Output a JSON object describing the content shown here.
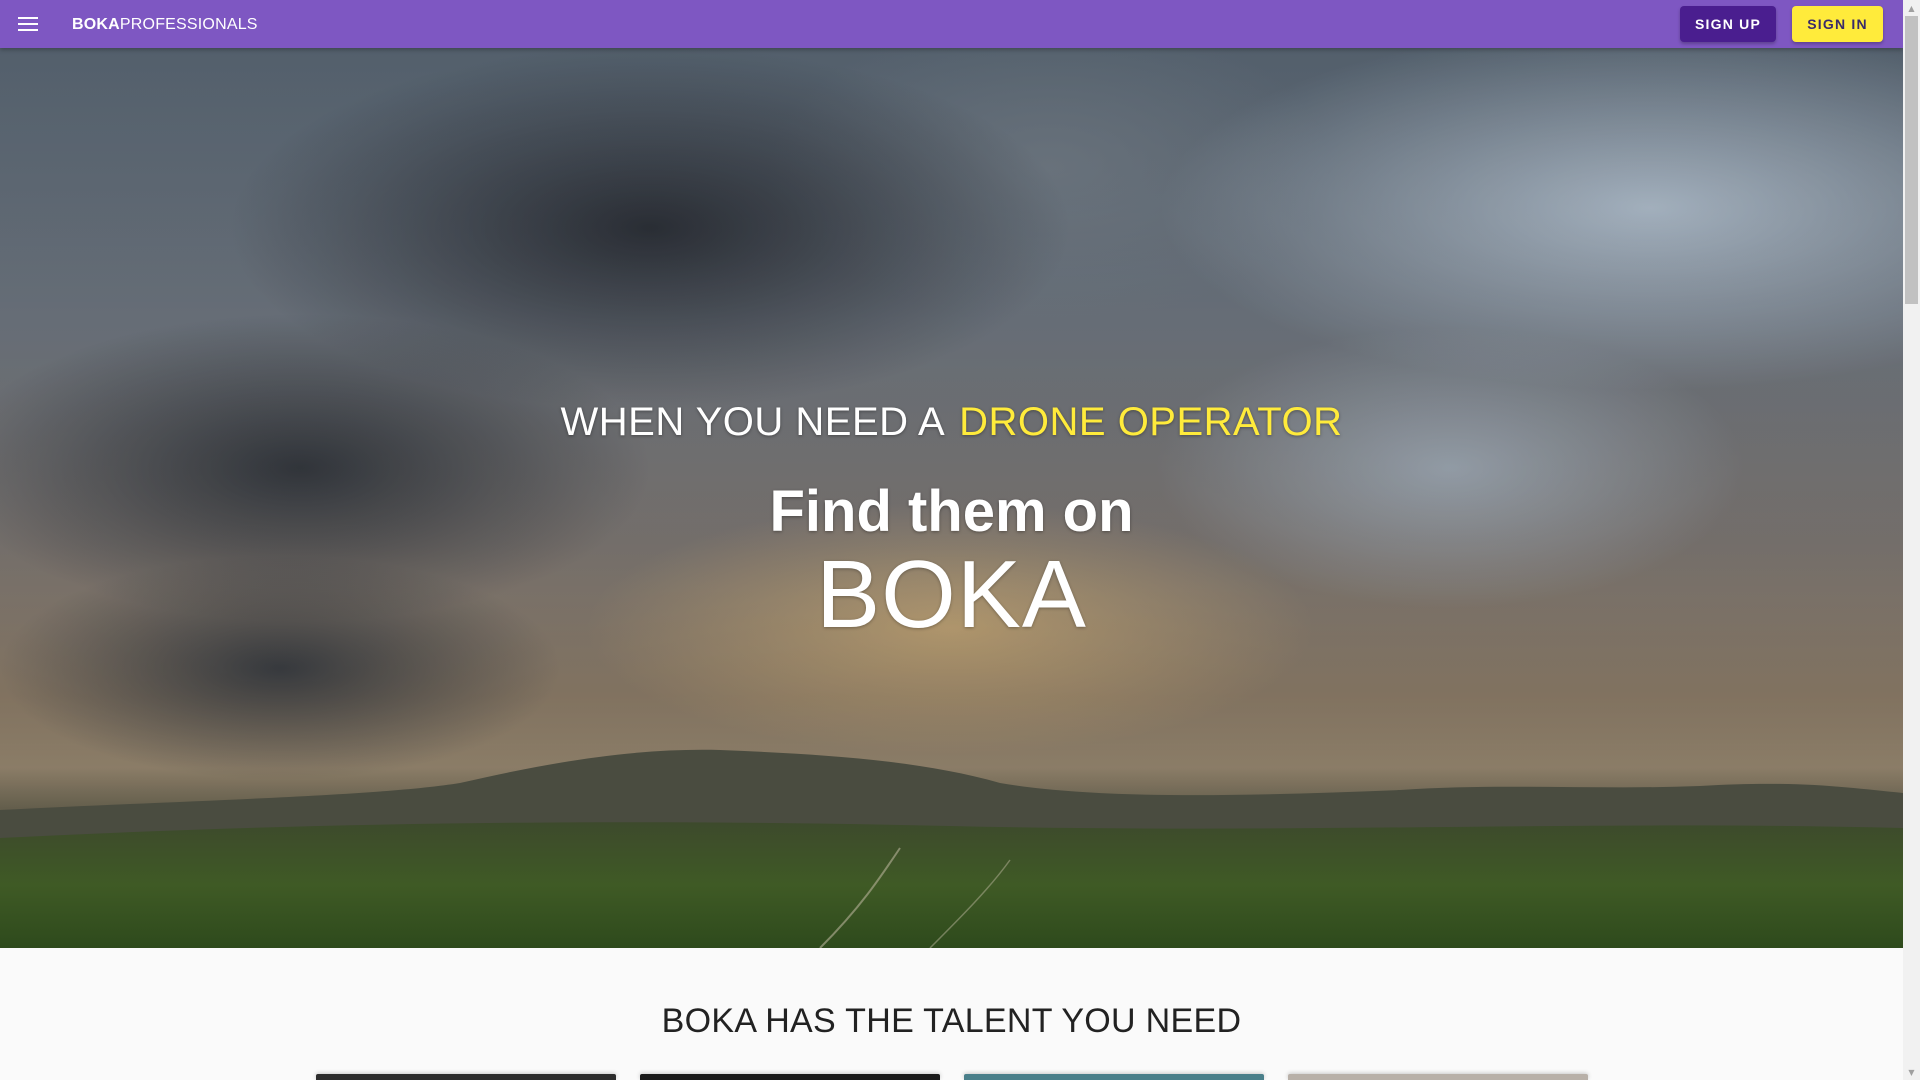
{
  "appbar": {
    "brand_bold": "BOKA",
    "brand_rest": "PROFESSIONALS",
    "menu_icon": "hamburger-menu-icon",
    "signup_label": "SIGN UP",
    "signin_label": "SIGN IN",
    "color": "#7e57c2",
    "signup_color": "#4a1e8f",
    "signin_color": "#ffeb3b"
  },
  "hero": {
    "tagline_prefix": "WHEN YOU NEED A",
    "tagline_accent": "DRONE OPERATOR",
    "headline": "Find them on",
    "brand_big": "BOKA",
    "accent_color": "#ffeb3b"
  },
  "talent": {
    "title": "BOKA HAS THE TALENT YOU NEED"
  },
  "scrollbar": {
    "up_icon": "scroll-up-arrow-icon",
    "down_icon": "scroll-down-arrow-icon"
  }
}
